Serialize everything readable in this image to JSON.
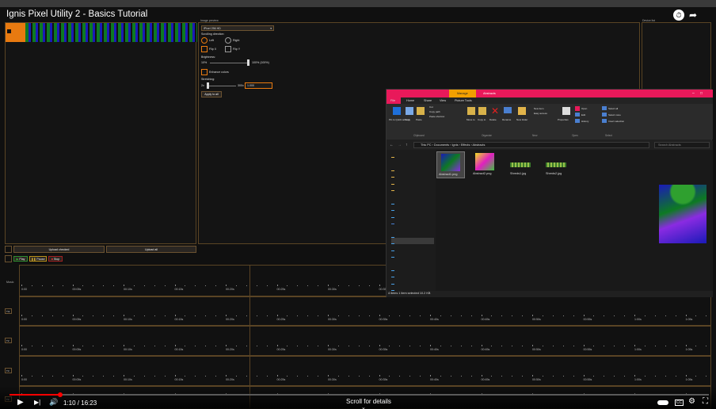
{
  "video": {
    "title": "Ignis Pixel Utility 2 - Basics Tutorial",
    "time": "1:10 / 16:23",
    "scroll_hint": "Scroll for details",
    "scroll_chevron": "⌄",
    "progress_fraction": 0.072
  },
  "app": {
    "image_preview_label": "Image preview",
    "device_list_label": "Device list",
    "device_select": "iPixel 256 HD",
    "device_select_arrow": "▾",
    "scroll_dir_label": "Scrolling direction:",
    "radio_left": "Left",
    "radio_right": "Right",
    "check_flip_x": "Flip X",
    "check_flip_y": "Flip Y",
    "brightness_label": "Brightness:",
    "brightness_min": "10%",
    "brightness_val": "100% (100%)",
    "enhance_label": "Enhance colors",
    "stretching_label": "Stretching:",
    "stretch_min": "2x",
    "stretch_mid": "300x",
    "stretch_val": "1.000",
    "apply_all": "Apply to all",
    "upload_checked": "Upload checked",
    "upload_all": "Upload all",
    "play": "Play",
    "pause": "Pause",
    "stop": "Stop",
    "music_label": "Music",
    "track_labels": [
      "Trk",
      "T2",
      "T3",
      "T4"
    ]
  },
  "timeline": {
    "ticks": [
      "0:00",
      "00:05s",
      "00:10s",
      "00:15s",
      "00:20s",
      "00:25s",
      "00:30s",
      "00:35s",
      "00:40s",
      "00:45s",
      "00:50s",
      "00:55s",
      "1:00s",
      "1:05s"
    ]
  },
  "explorer": {
    "tab_manage": "Manage",
    "tab_title": "Abstracts",
    "menu": [
      "File",
      "Home",
      "Share",
      "View",
      "Picture Tools"
    ],
    "ribbon_clipboard": "Clipboard",
    "ribbon_organize": "Organize",
    "ribbon_new": "New",
    "ribbon_open": "Open",
    "ribbon_select": "Select",
    "ribbon_items": [
      "Pin to Quick access",
      "Copy",
      "Paste",
      "Cut",
      "Copy path",
      "Paste shortcut",
      "Move to",
      "Copy to",
      "Delete",
      "Rename",
      "New folder",
      "New item",
      "Easy access",
      "Properties",
      "Open",
      "Edit",
      "History",
      "Select all",
      "Select none",
      "Invert selection"
    ],
    "path": "This PC › Documents › Ignis › Effects › Abstracts",
    "search_placeholder": "Search Abstracts",
    "nav_items": [
      "Desktop",
      "Downloads",
      "Ignis",
      "Desktop",
      "One Each",
      "Transforming M.",
      "Three or Four Ea.",
      "Creative Cloud Fil.",
      "OneDrive",
      "OneDrive - Custom",
      "This PC",
      "3D Objects",
      "Desktop",
      "Documents",
      "Downloads",
      "Music",
      "Pictures",
      "Videos",
      "Windows (C:)",
      "New Volume (D:",
      "Network"
    ],
    "files": [
      "Abstract1.png",
      "Abstract2.png",
      "Shreds1.jpg",
      "Shreds2.jpg"
    ],
    "status": "4 items   1 item selected  10.2 KB"
  },
  "colors": {
    "accent": "#e8195a",
    "timeline_border": "#5a4424",
    "progress": "#ff0000"
  }
}
